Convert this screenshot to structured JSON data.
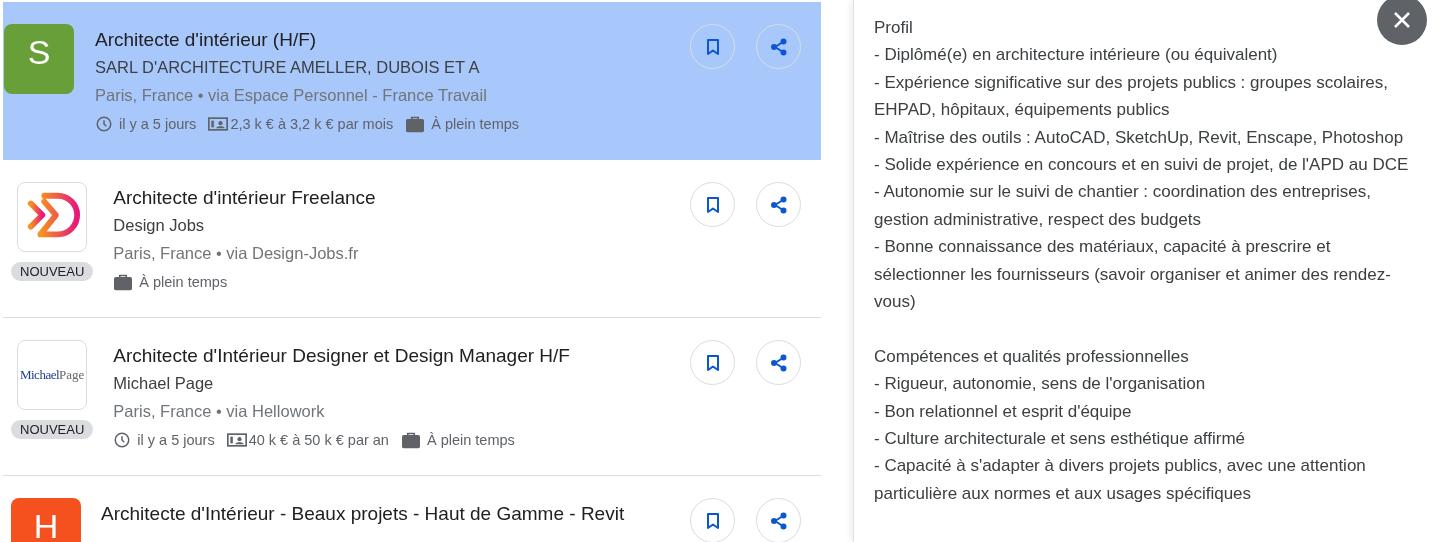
{
  "jobs": [
    {
      "selected": true,
      "logo": {
        "kind": "letter",
        "text": "S",
        "color": "#689f38"
      },
      "title": "Architecte d'intérieur (H/F)",
      "company": "SARL D'ARCHITECTURE AMELLER, DUBOIS ET A",
      "location": "Paris, France • via Espace Personnel - France Travail",
      "meta": [
        {
          "kind": "clock",
          "text": "il y a 5 jours"
        },
        {
          "kind": "salary",
          "text": "2,3 k € à 3,2 k € par mois"
        },
        {
          "kind": "briefcase",
          "text": "À plein temps"
        }
      ]
    },
    {
      "selected": false,
      "logo": {
        "kind": "chevron"
      },
      "badge": "NOUVEAU",
      "title": "Architecte d'intérieur Freelance",
      "company": "Design Jobs",
      "location": "Paris, France • via Design-Jobs.fr",
      "meta": [
        {
          "kind": "briefcase",
          "text": "À plein temps"
        }
      ]
    },
    {
      "selected": false,
      "logo": {
        "kind": "wordmark",
        "text": "Michael",
        "text2": "Page"
      },
      "badge": "NOUVEAU",
      "title": "Architecte d'Intérieur Designer et Design Manager H/F",
      "company": "Michael Page",
      "location": "Paris, France • via Hellowork",
      "meta": [
        {
          "kind": "clock",
          "text": "il y a 5 jours"
        },
        {
          "kind": "salary",
          "text": "40 k € à 50 k € par an"
        },
        {
          "kind": "briefcase",
          "text": "À plein temps"
        }
      ]
    },
    {
      "selected": false,
      "logo": {
        "kind": "letter",
        "text": "H",
        "color": "#f4511e"
      },
      "title": "Architecte d'Intérieur - Beaux projets - Haut de Gamme - Revit"
    }
  ],
  "detail": {
    "paragraphs": [
      [
        "Profil",
        "- Diplômé(e) en architecture intérieure (ou équivalent)",
        "- Expérience significative sur des projets publics : groupes scolaires, EHPAD, hôpitaux, équipements publics",
        "- Maîtrise des outils : AutoCAD, SketchUp, Revit, Enscape, Photoshop",
        "- Solide expérience en concours et en suivi de projet, de l'APD au DCE",
        "- Autonomie sur le suivi de chantier : coordination des entreprises, gestion administrative, respect des budgets",
        "- Bonne connaissance des matériaux, capacité à prescrire et sélectionner les fournisseurs (savoir organiser et animer des rendez-vous)"
      ],
      [
        "Compétences et qualités professionnelles",
        "- Rigueur, autonomie, sens de l'organisation",
        "- Bon relationnel et esprit d'équipe",
        "- Culture architecturale et sens esthétique affirmé",
        "- Capacité à s'adapter à divers projets publics, avec une attention particulière aux normes et aux usages spécifiques"
      ]
    ]
  }
}
